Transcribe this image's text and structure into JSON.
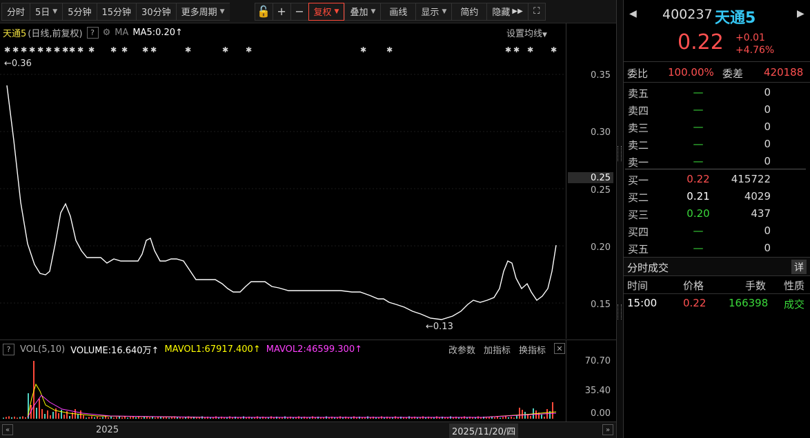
{
  "toolbar": {
    "items": [
      "分时",
      "5日",
      "5分钟",
      "15分钟",
      "30分钟",
      "更多周期"
    ],
    "tools": [
      "复权",
      "叠加",
      "画线",
      "显示",
      "简约",
      "隐藏"
    ]
  },
  "chart": {
    "name": "天通5",
    "mode": "(日线,前复权)",
    "ma_label": "MA",
    "ma5": "MA5:0.20",
    "settings": "设置均线",
    "max_marker": "←0.36",
    "min_marker": "←0.13",
    "y_labels": [
      "0.35",
      "0.30",
      "0.25",
      "0.25",
      "0.20",
      "0.15"
    ],
    "vol_title": "VOL(5,10)",
    "volume": "VOLUME:16.640万",
    "mavol1": "MAVOL1:67917.400",
    "mavol2": "MAVOL2:46599.300",
    "vol_actions": [
      "改参数",
      "加指标",
      "换指标"
    ],
    "vol_y_labels": [
      "70.70",
      "35.40",
      "0.00"
    ],
    "x_year": "2025",
    "x_date": "2025/11/20/四",
    "colors": {
      "up": "#ff4a3a",
      "down": "#50d0c0",
      "price_line": "#ffffff",
      "ma1": "#ffff00",
      "ma2": "#ff00ff"
    }
  },
  "quote": {
    "code": "400237",
    "name": "天通5",
    "price": "0.22",
    "change": "+0.01",
    "change_pct": "+4.76%",
    "weibi_label": "委比",
    "weibi": "100.00%",
    "weicha_label": "委差",
    "weicha": "420188",
    "asks": [
      {
        "label": "卖五",
        "price": "—",
        "vol": "0"
      },
      {
        "label": "卖四",
        "price": "—",
        "vol": "0"
      },
      {
        "label": "卖三",
        "price": "—",
        "vol": "0"
      },
      {
        "label": "卖二",
        "price": "—",
        "vol": "0"
      },
      {
        "label": "卖一",
        "price": "—",
        "vol": "0"
      }
    ],
    "bids": [
      {
        "label": "买一",
        "price": "0.22",
        "vol": "415722",
        "color": "#ff5050"
      },
      {
        "label": "买二",
        "price": "0.21",
        "vol": "4029",
        "color": "#ffffff"
      },
      {
        "label": "买三",
        "price": "0.20",
        "vol": "437",
        "color": "#3ad83a"
      },
      {
        "label": "买四",
        "price": "—",
        "vol": "0",
        "color": "#3ad83a"
      },
      {
        "label": "买五",
        "price": "—",
        "vol": "0",
        "color": "#3ad83a"
      }
    ]
  },
  "trades": {
    "title": "分时成交",
    "detail": "详",
    "cols": [
      "时间",
      "价格",
      "手数",
      "性质"
    ],
    "rows": [
      {
        "time": "15:00",
        "price": "0.22",
        "qty": "166398",
        "type": "成交"
      }
    ]
  }
}
